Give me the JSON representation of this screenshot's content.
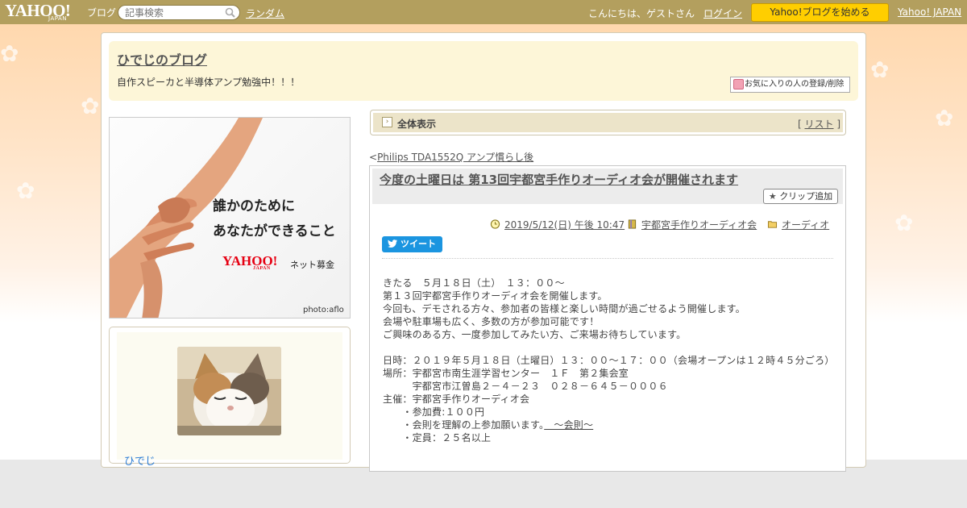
{
  "topbar": {
    "logo_text": "YAHOO!",
    "logo_sub": "JAPAN",
    "logo_blog": "ブログ",
    "search_placeholder": "記事検索",
    "random_link": "ランダム",
    "greeting": "こんにちは、ゲストさん",
    "login_link": "ログイン",
    "start_button": "Yahoo!ブログを始める",
    "yahoo_japan_link": "Yahoo! JAPAN",
    "bar_color": "#b39f5e",
    "start_button_color": "#ffce00"
  },
  "header": {
    "blog_title": "ひでじのブログ",
    "blog_description": "自作スピーカと半導体アンプ勉強中！！！",
    "favorite_button": "お気に入りの人の登録/削除"
  },
  "ad": {
    "line1": "誰かのために",
    "line2": "あなたができること",
    "logo_text": "YAHOO!",
    "logo_sub": "JAPAN",
    "tagline": "ネット募金",
    "credit": "photo:aflo"
  },
  "profile": {
    "nickname": "ひでじ",
    "link_color": "#2a7bd4"
  },
  "view": {
    "label": "全体表示",
    "list_prefix": "[ ",
    "list_link": "リスト",
    "list_suffix": " ]"
  },
  "navigation": {
    "prev_marker": "<",
    "prev_title": "Philips TDA1552Q アンプ慣らし後"
  },
  "article": {
    "title": "今度の土曜日は 第13回宇都宮手作りオーディオ会が開催されます",
    "clip_button": "クリップ追加",
    "date": "2019/5/12(日) 午後 10:47",
    "tag": "宇都宮手作りオーディオ会",
    "category": "オーディオ",
    "tweet_button": "ツイート",
    "body": [
      {
        "text": "きたる　５月１８日（土）　１３：００～"
      },
      {
        "text": "第１３回宇都宮手作りオーディオ会を開催します。"
      },
      {
        "text": "今回も、デモされる方々、参加者の皆様と楽しい時間が過ごせるよう開催します。"
      },
      {
        "text": "会場や駐車場も広く、多数の方が参加可能です！"
      },
      {
        "text": "ご興味のある方、一度参加してみたい方、ご来場お待ちしています。"
      },
      {
        "text": ""
      },
      {
        "text": "日時：２０１９年５月１８日（土曜日）１３：００～１７：００（会場オープンは１２時４５分ごろ）"
      },
      {
        "text": "場所：宇都宮市南生涯学習センター　１Ｆ　第２集会室"
      },
      {
        "text": "　　　宇都宮市江曽島２－４－２３　０２８－６４５－０００６"
      },
      {
        "text": "主催：宇都宮手作りオーディオ会"
      },
      {
        "text": "　　・参加費:１００円"
      },
      {
        "text": "　　・会則を理解の上参加願います。",
        "link": "　～会則～"
      },
      {
        "text": "　　・定員：２５名以上"
      }
    ]
  }
}
